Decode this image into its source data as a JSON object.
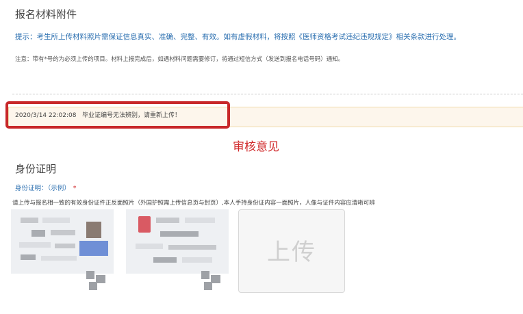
{
  "attachments": {
    "title": "报名材料附件",
    "tip": "提示：考生所上传材料照片需保证信息真实、准确、完整、有效。如有虚假材料，将按照《医师资格考试违纪违规规定》相关条款进行处理。",
    "note": "注意：带有*号的为必须上传的项目。材料上报完成后，如遇材料问题需要修订，将通过短信方式（发送到报名电话号码）通知。"
  },
  "review": {
    "timestamp": "2020/3/14 22:02:08",
    "message": "毕业证编号无法辨别，请重新上传！",
    "annotation": "审核意见",
    "highlight_color": "#c8282a"
  },
  "identity": {
    "title": "身份证明",
    "label": "身份证明：",
    "example_link": "（示例）",
    "required_mark": "*",
    "description": "请上传与报名相一致的有效身份证件正反面照片（外国护照需上传信息页与封页）,本人手持身份证内容一面照片，人像与证件内容应清晰可辨",
    "upload_label": "上传"
  }
}
